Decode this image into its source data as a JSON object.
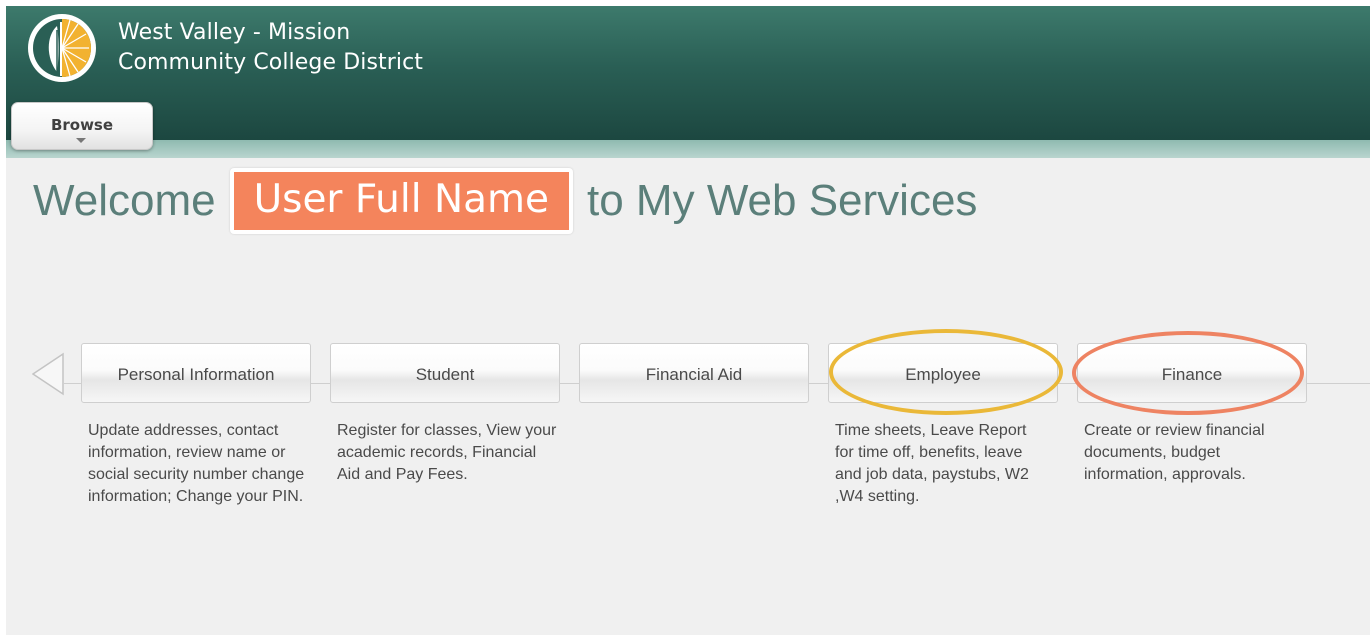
{
  "header": {
    "org_name_line1": "West Valley - Mission",
    "org_name_line2": "Community College District",
    "logo_icon": "leaf-sun-logo-icon"
  },
  "browse_tab": {
    "label": "Browse"
  },
  "welcome": {
    "prefix": "Welcome",
    "user_name": "User Full Name",
    "suffix": "to My Web Services"
  },
  "nav": {
    "items": [
      {
        "label": "Personal Information",
        "description": "Update addresses, contact information, review name or social security number change information; Change your PIN."
      },
      {
        "label": "Student",
        "description": "Register for classes, View your academic records, Financial Aid and Pay Fees."
      },
      {
        "label": "Financial Aid",
        "description": ""
      },
      {
        "label": "Employee",
        "description": "Time sheets, Leave Report for time off, benefits, leave and job data, paystubs, W2 ,W4 setting."
      },
      {
        "label": "Finance",
        "description": "Create or review financial documents, budget information, approvals."
      }
    ]
  },
  "colors": {
    "header_dark": "#1c4740",
    "header_light": "#3d7a6c",
    "name_badge": "#f4845c",
    "welcome_text": "#5b7f7a",
    "employee_highlight": "#eab838",
    "finance_highlight": "#ee8362"
  }
}
